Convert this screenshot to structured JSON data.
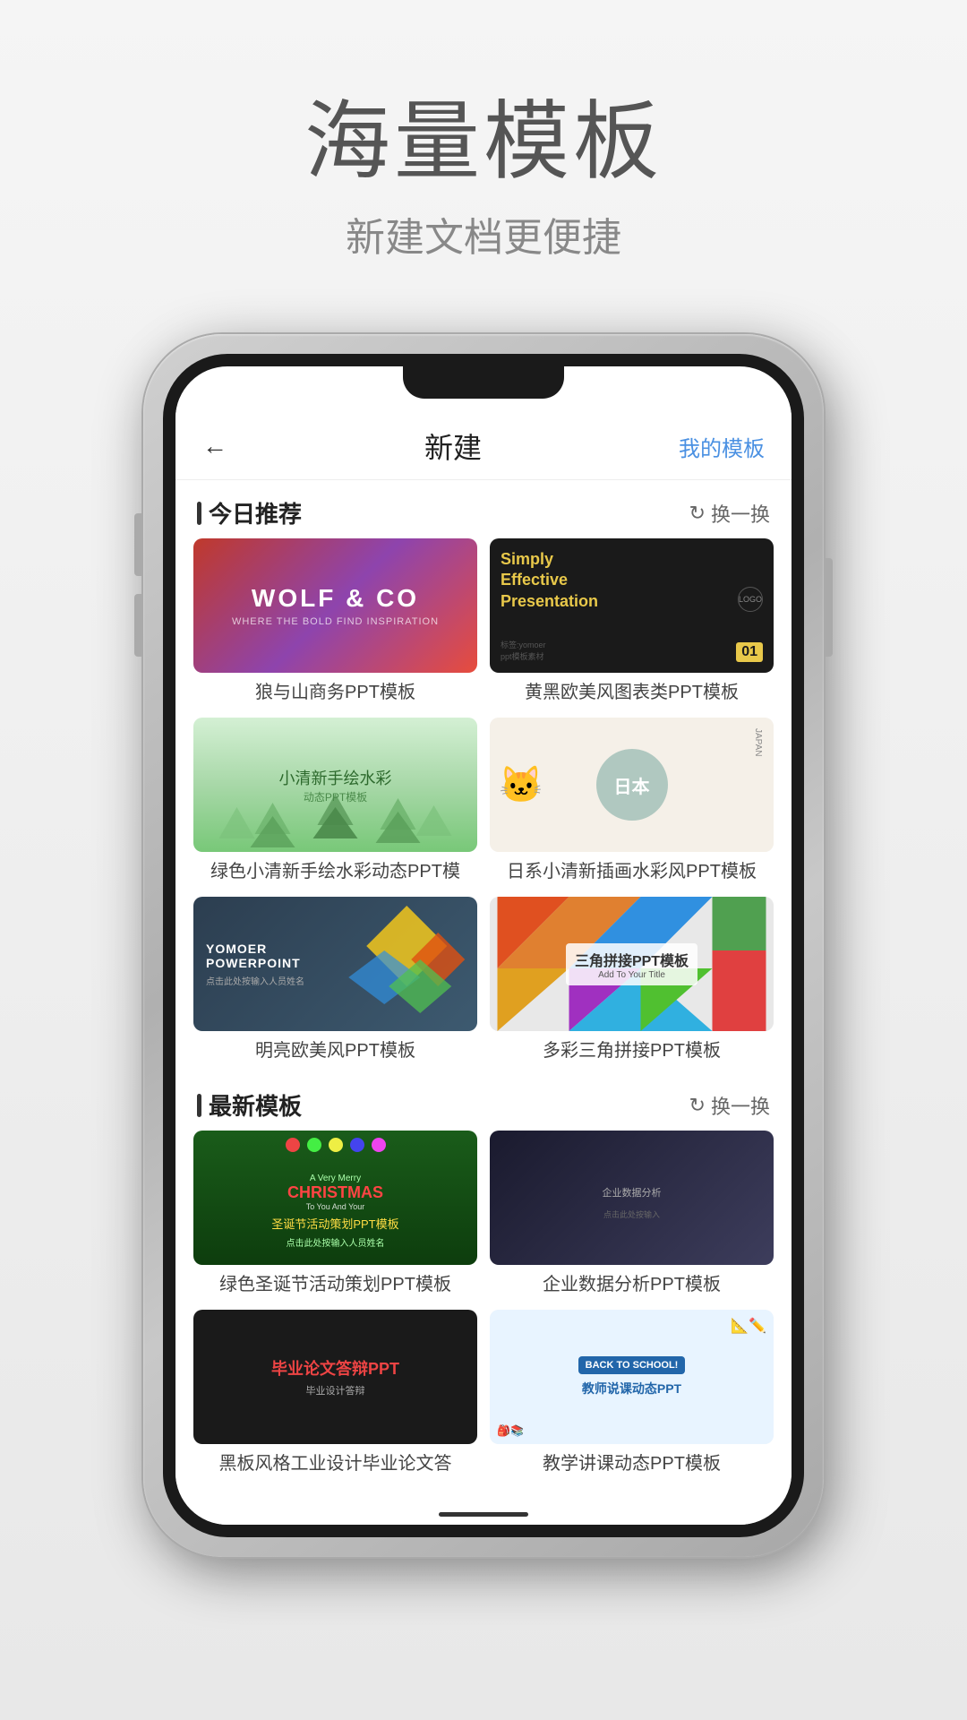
{
  "page": {
    "title": "海量模板",
    "subtitle": "新建文档更便捷"
  },
  "app": {
    "navbar": {
      "back_label": "←",
      "title": "新建",
      "action_label": "我的模板"
    },
    "section_today": {
      "title": "今日推荐",
      "refresh_label": "换一换"
    },
    "section_latest": {
      "title": "最新模板",
      "refresh_label": "换一换"
    },
    "templates_today": [
      {
        "id": "wolf",
        "title_text": "WOLF & CO",
        "label": "狼与山商务PPT模板"
      },
      {
        "id": "simply",
        "title_text": "Simply Effective Presentation",
        "label": "黄黑欧美风图表类PPT模板"
      },
      {
        "id": "watercolor",
        "title_text": "小清新手绘水彩",
        "subtitle_text": "动态PPT模板",
        "label": "绿色小清新手绘水彩动态PPT模"
      },
      {
        "id": "japan",
        "title_text": "日本",
        "label": "日系小清新插画水彩风PPT模板"
      },
      {
        "id": "yomoer",
        "title_text": "YOMOER POWERPOINT",
        "subtitle_text": "点击此处按输入人员姓名",
        "label": "明亮欧美风PPT模板"
      },
      {
        "id": "triangle",
        "title_text": "三角拼接PPT模板",
        "subtitle_text": "Add To Your Title",
        "label": "多彩三角拼接PPT模板"
      }
    ],
    "templates_latest": [
      {
        "id": "christmas",
        "title_text": "Christmas",
        "subtitle_text": "圣诞节活动策划PPT模板",
        "label": "绿色圣诞节活动策划PPT模板"
      },
      {
        "id": "business",
        "title_text": "企业数据分析",
        "label": "企业数据分析PPT模板"
      },
      {
        "id": "thesis",
        "title_text": "毕业论文答辩PPT",
        "subtitle_text": "",
        "label": "黑板风格工业设计毕业论文答"
      },
      {
        "id": "teacher",
        "title_text": "教师说课动态PPT",
        "label": "教学讲课动态PPT模板"
      }
    ]
  }
}
